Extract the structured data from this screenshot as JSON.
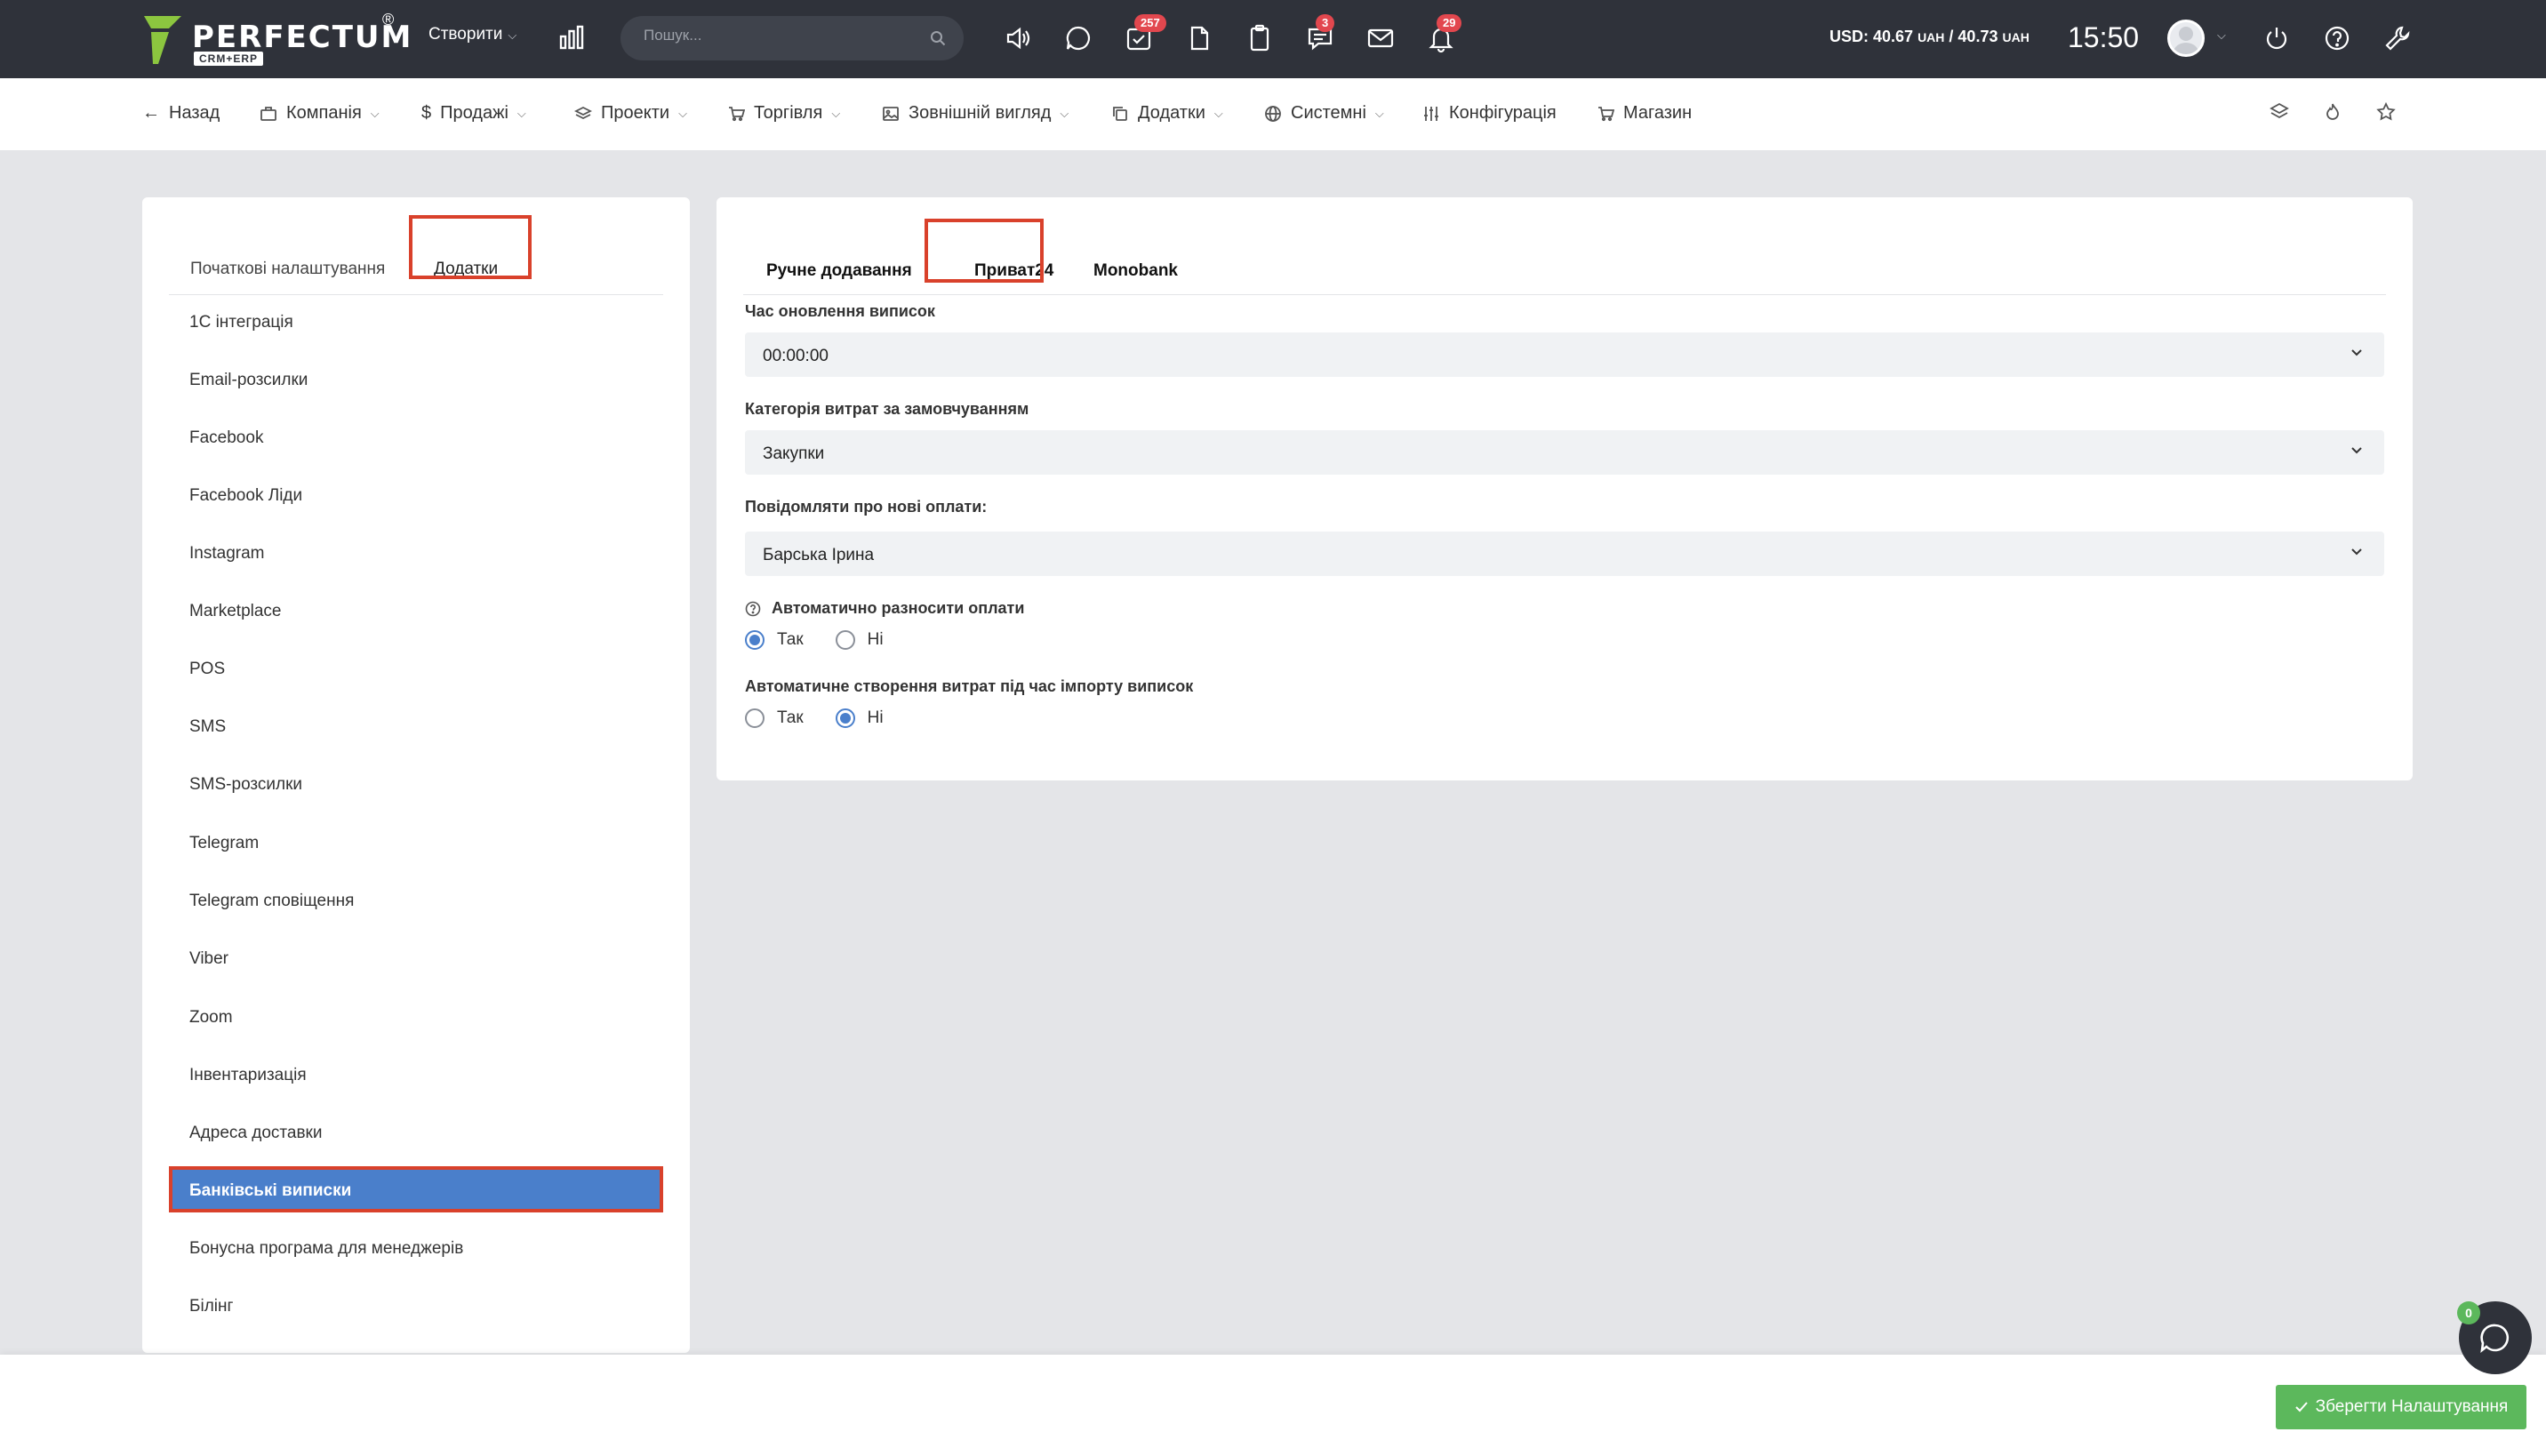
{
  "brand": {
    "name": "PERFECTUM",
    "sub": "CRM+ERP",
    "reg": "®"
  },
  "topbar": {
    "create_label": "Створити",
    "search_placeholder": "Пошук...",
    "badges": {
      "tasks": "257",
      "chat": "3",
      "notifications": "29"
    },
    "currency_usd": "USD: 40.67",
    "currency_uah1": "UAH",
    "currency_sep": "/ 40.73",
    "currency_uah2": "UAH",
    "time": "15:50"
  },
  "nav": {
    "back": "Назад",
    "company": "Компанія",
    "sales": "Продажі",
    "projects": "Проекти",
    "trade": "Торгівля",
    "appearance": "Зовнішній вигляд",
    "addons": "Додатки",
    "system": "Системні",
    "config": "Конфігурація",
    "shop": "Магазин"
  },
  "left_tabs": {
    "initial": "Початкові налаштування",
    "addons": "Додатки"
  },
  "left_menu": [
    "1С інтеграція",
    "Email-розсилки",
    "Facebook",
    "Facebook Ліди",
    "Instagram",
    "Marketplace",
    "POS",
    "SMS",
    "SMS-розсилки",
    "Telegram",
    "Telegram сповіщення",
    "Viber",
    "Zoom",
    "Інвентаризація",
    "Адреса доставки",
    "Банківські виписки",
    "Бонусна програма для менеджерів",
    "Білінг"
  ],
  "right_tabs": {
    "manual": "Ручне додавання",
    "privat": "Приват24",
    "mono": "Monobank"
  },
  "form": {
    "update_time_label": "Час оновлення виписок",
    "update_time_value": "00:00:00",
    "category_label": "Категорія витрат за замовчуванням",
    "category_value": "Закупки",
    "notify_label": "Повідомляти про нові оплати:",
    "notify_value": "Барська Ірина",
    "auto_pay_label": "Автоматично разносити оплати",
    "auto_expense_label": "Автоматичне створення витрат під час імпорту виписок",
    "yes": "Так",
    "no": "Ні"
  },
  "footer": {
    "save_label": "Зберегти Налаштування",
    "chat_count": "0"
  }
}
